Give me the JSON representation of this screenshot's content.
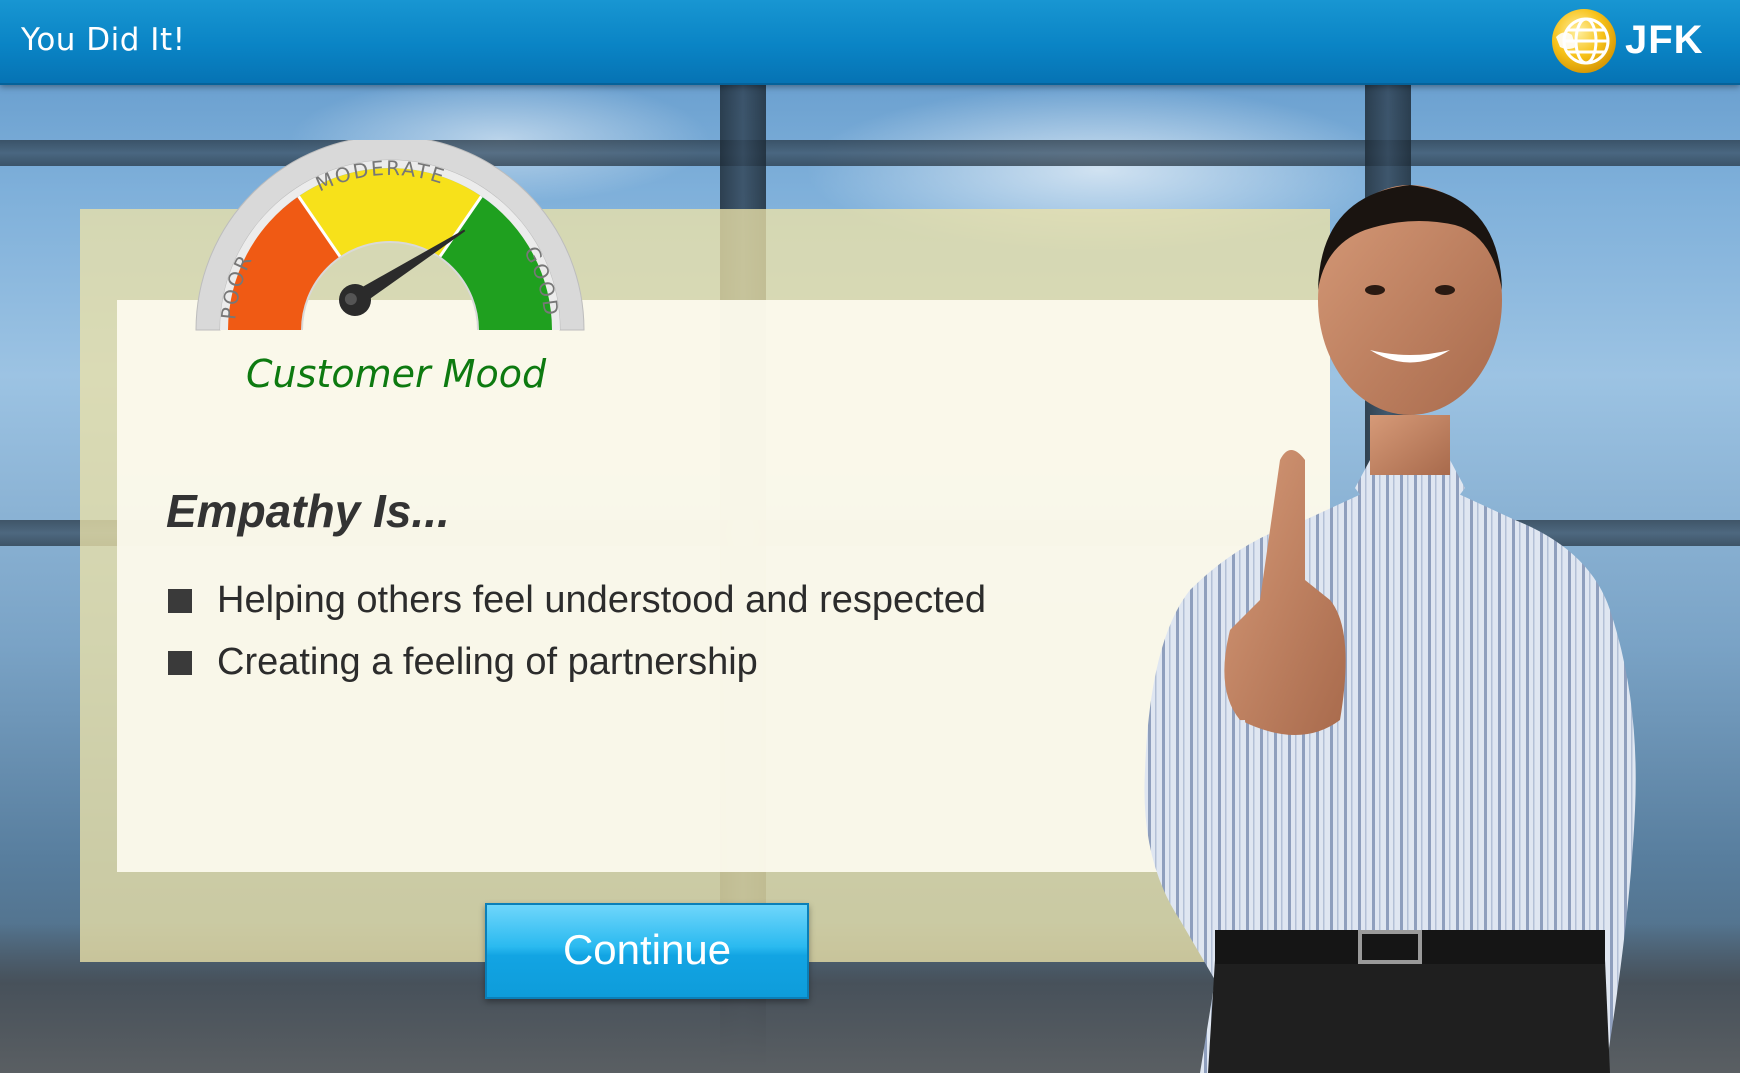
{
  "topbar": {
    "title": "You Did It!",
    "logo_text": "JFK"
  },
  "gauge": {
    "label": "Customer Mood",
    "zones": [
      "POOR",
      "MODERATE",
      "GOOD"
    ],
    "level": 0.82
  },
  "content": {
    "heading": "Empathy Is...",
    "bullets": [
      "Helping others feel understood and respected",
      "Creating a feeling of partnership"
    ]
  },
  "actions": {
    "continue_label": "Continue"
  },
  "colors": {
    "topbar": "#0a84c5",
    "gauge_poor": "#f05a14",
    "gauge_moderate": "#f7e11a",
    "gauge_good": "#1fa01f",
    "mood_label": "#0d7a10",
    "button": "#2bbaf0"
  },
  "icons": {
    "logo": "globe-icon",
    "bullet": "square-bullet-icon"
  }
}
